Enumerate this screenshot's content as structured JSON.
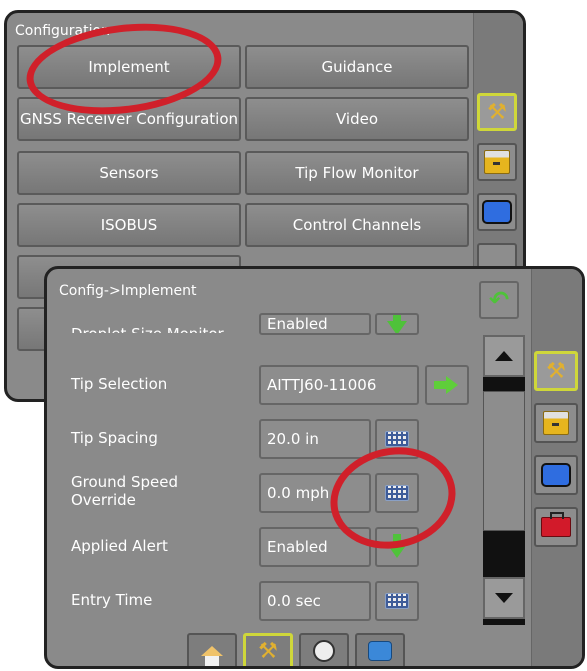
{
  "back_panel": {
    "title": "Configuration",
    "buttons": [
      {
        "label": "Implement"
      },
      {
        "label": "Guidance"
      },
      {
        "label": "GNSS Receiver Configuration"
      },
      {
        "label": "Video"
      },
      {
        "label": "Sensors"
      },
      {
        "label": "Tip Flow Monitor"
      },
      {
        "label": "ISOBUS"
      },
      {
        "label": "Control Channels"
      }
    ]
  },
  "front_panel": {
    "title": "Config->Implement",
    "rows": [
      {
        "label": "Droplet Size Monitor",
        "value": "Enabled"
      },
      {
        "label": "Tip Selection",
        "value": "AITTJ60-11006"
      },
      {
        "label": "Tip Spacing",
        "value": "20.0 in"
      },
      {
        "label": "Ground Speed Override",
        "value": "0.0 mph"
      },
      {
        "label": "Applied Alert",
        "value": "Enabled"
      },
      {
        "label": "Entry Time",
        "value": "0.0 sec"
      }
    ]
  },
  "colors": {
    "panel_bg": "#8a8a8a",
    "selected_border": "#cfd73a",
    "highlight_ellipse": "#d0202a",
    "green_arrow": "#4fc23a"
  },
  "icons": {
    "back": "return-arrow-icon",
    "tools": "tools-icon",
    "drawer": "drawer-icon",
    "screen": "screen-icon",
    "toolbox": "toolbox-icon",
    "home": "home-icon",
    "gauge": "gauge-icon",
    "help": "help-icon"
  }
}
